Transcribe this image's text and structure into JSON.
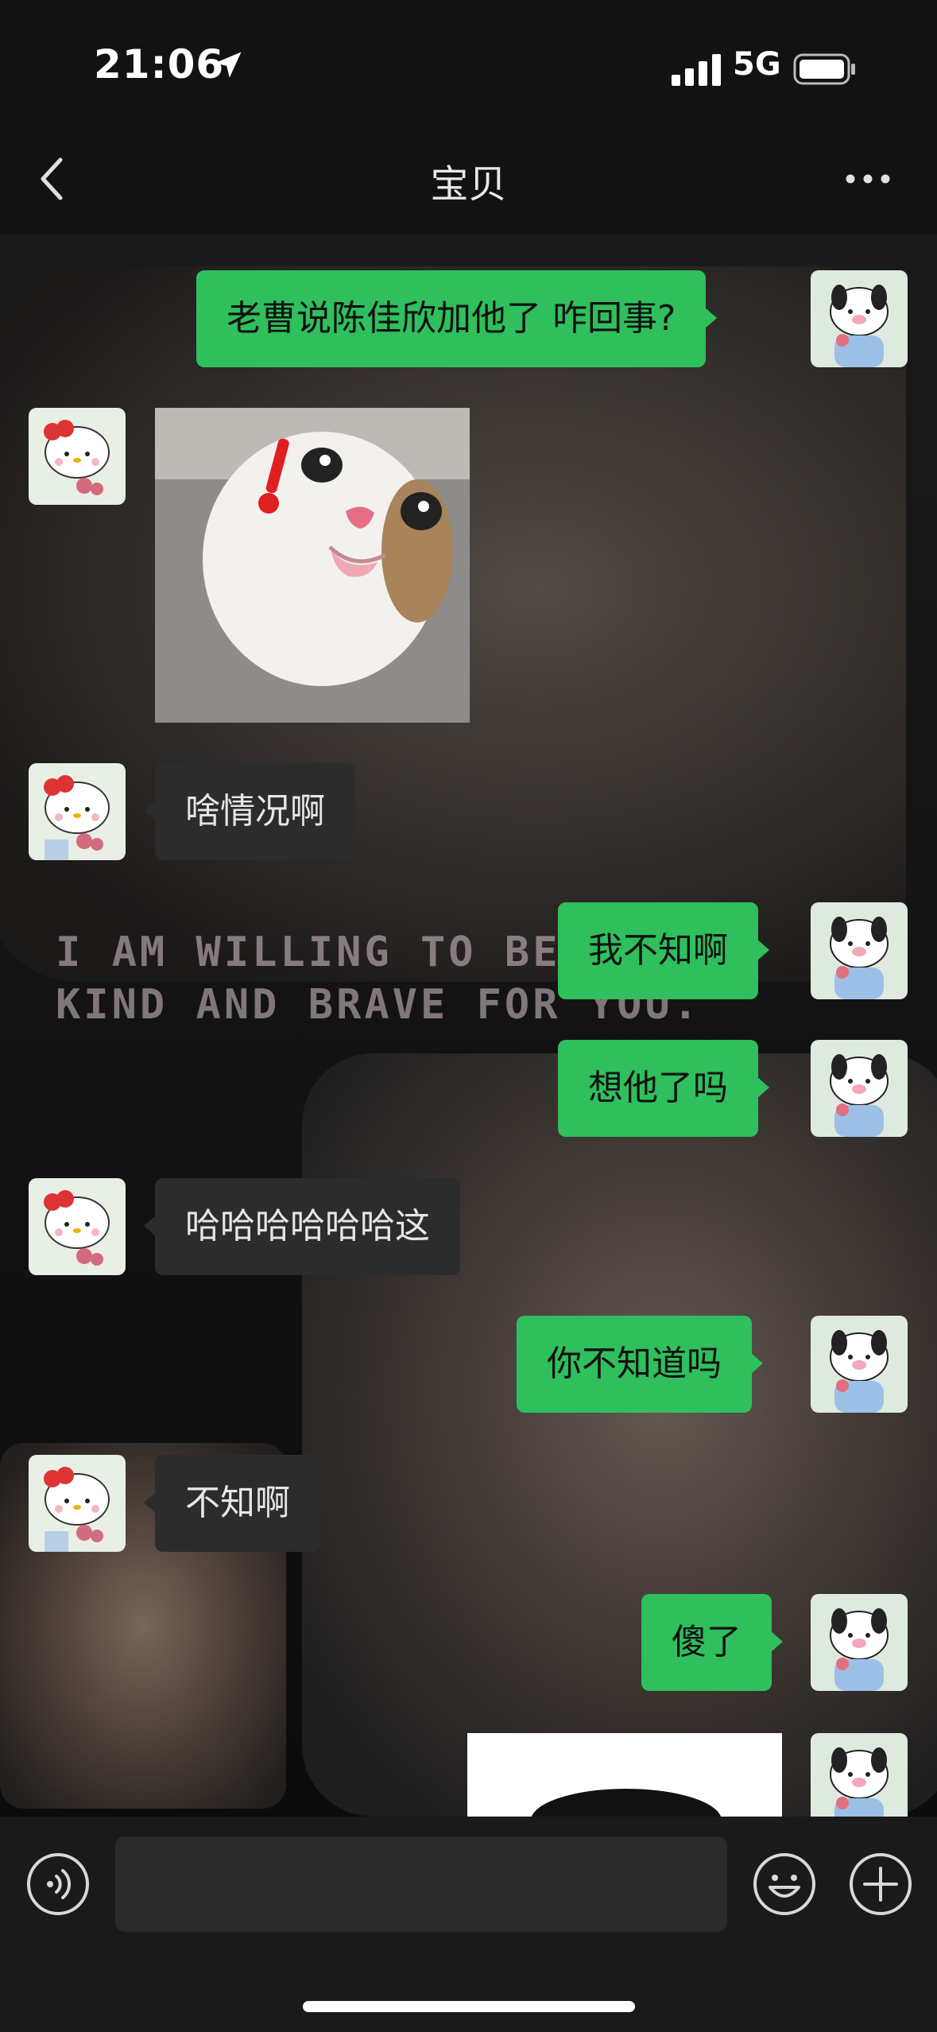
{
  "status_bar": {
    "time": "21:06",
    "network": "5G"
  },
  "nav": {
    "title": "宝贝"
  },
  "background": {
    "caption_line1": "I AM WILLING TO BE",
    "caption_line2": "KIND AND BRAVE FOR YOU."
  },
  "messages": [
    {
      "from": "me",
      "type": "text",
      "text": "老曹说陈佳欣加他了 咋回事?"
    },
    {
      "from": "them",
      "type": "sticker",
      "sticker": "surprised-cat-sticker"
    },
    {
      "from": "them",
      "type": "text",
      "text": "啥情况啊"
    },
    {
      "from": "me",
      "type": "text",
      "text": "我不知啊"
    },
    {
      "from": "me",
      "type": "text",
      "text": "想他了吗"
    },
    {
      "from": "them",
      "type": "text",
      "text": "哈哈哈哈哈哈这"
    },
    {
      "from": "me",
      "type": "text",
      "text": "你不知道吗"
    },
    {
      "from": "them",
      "type": "text",
      "text": "不知啊"
    },
    {
      "from": "me",
      "type": "text",
      "text": "傻了"
    },
    {
      "from": "me",
      "type": "image",
      "image": "partial-image"
    }
  ],
  "colors": {
    "me_bubble": "#2fbf5d",
    "them_bubble": "#2c2c2c",
    "bar": "#121212"
  },
  "icons": [
    "location-arrow-icon",
    "signal-icon",
    "battery-icon",
    "back-icon",
    "more-icon",
    "voice-icon",
    "emoji-icon",
    "plus-icon"
  ]
}
